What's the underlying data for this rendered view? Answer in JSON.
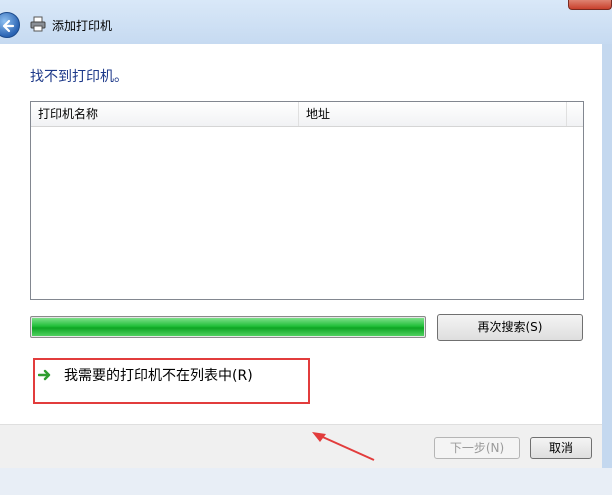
{
  "window": {
    "title": "添加打印机"
  },
  "content": {
    "heading": "找不到打印机。",
    "list": {
      "columns": [
        "打印机名称",
        "地址"
      ],
      "rows": []
    },
    "progress": {
      "value": 1.0
    },
    "search_again_label": "再次搜索(S)",
    "not_listed_link": "我需要的打印机不在列表中(R)"
  },
  "footer": {
    "next_label": "下一步(N)",
    "cancel_label": "取消"
  },
  "colors": {
    "heading": "#1e3a8a",
    "progress": "#22c03a",
    "annotation": "#e23c3c"
  }
}
